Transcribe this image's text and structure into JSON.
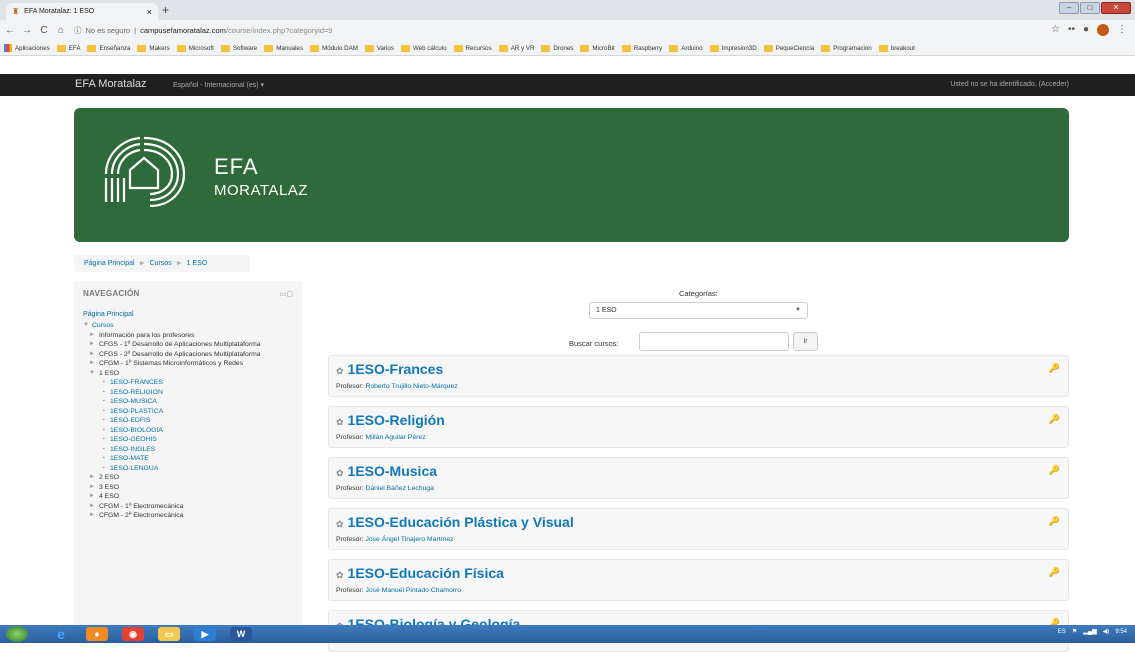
{
  "browser": {
    "tab_title": "EFA Moratalaz: 1 ESO",
    "tab_close": "×",
    "new_tab": "+",
    "security": "No es seguro",
    "url_host": "campusefamoratalaz.com",
    "url_path": "/course/index.php?categoryid=9",
    "bookmarks": [
      "Aplicaciones",
      "EFA",
      "Enseñanza",
      "Makers",
      "Microsoft",
      "Software",
      "Manuales",
      "Módulo DAM",
      "Varios",
      "Web cálculo",
      "Recursos",
      "AR y VR",
      "Drones",
      "MicroBit",
      "Raspberry",
      "Arduino",
      "Impresion3D",
      "PequeCiencia",
      "Programacion",
      "breakout"
    ]
  },
  "navbar": {
    "brand": "EFA Moratalaz",
    "language": "Español - Internacional (es) ▾",
    "login": "Usted no se ha identificado. (Acceder)"
  },
  "banner": {
    "title": "EFA",
    "subtitle": "MORATALAZ"
  },
  "breadcrumb": {
    "home": "Página Principal",
    "courses": "Cursos",
    "current": "1 ESO",
    "sep": "►"
  },
  "navigation": {
    "header": "NAVEGACIÓN",
    "home": "Página Principal",
    "courses": "Cursos",
    "categories": [
      "Información para los profesores",
      "CFGS - 1º Desarrollo de Aplicaciones Multiplataforma",
      "CFGS - 2º Desarrollo de Aplicaciones Multiplataforma",
      "CFGM - 1º Sistemas Microinformáticos y Redes"
    ],
    "open_category": "1 ESO",
    "sub_courses": [
      "1ESO-FRANCES",
      "1ESO-RELIGION",
      "1ESO-MUSICA",
      "1ESO-PLASTICA",
      "1ESO-EDFIS",
      "1ESO-BIOLOGIA",
      "1ESO-GEOHIS",
      "1ESO-INGLES",
      "1ESO-MATE",
      "1ESO-LENGUA"
    ],
    "more_categories": [
      "2 ESO",
      "3 ESO",
      "4 ESO",
      "CFGM - 1º Electromecánica",
      "CFGM - 2º Electromecánica"
    ]
  },
  "main": {
    "categories_label": "Categorías:",
    "selected_category": "1 ESO",
    "search_label": "Buscar cursos:",
    "search_button": "Ir",
    "teacher_prefix": "Profesor: ",
    "courses": [
      {
        "name": "1ESO-Frances",
        "teacher": "Roberto Trujillo Nieto-Márquez"
      },
      {
        "name": "1ESO-Religión",
        "teacher": "Millán Aguilar Pérez"
      },
      {
        "name": "1ESO-Musica",
        "teacher": "Daniel Báñez Lechuga"
      },
      {
        "name": "1ESO-Educación Plástica y Visual",
        "teacher": "Jose Ángel Tinajero Martínez"
      },
      {
        "name": "1ESO-Educación Física",
        "teacher": "José Manuel Pintado Chamorro"
      },
      {
        "name": "1ESO-Biología y Geología",
        "teacher": ""
      }
    ]
  },
  "taskbar": {
    "lang": "ES",
    "time": "9:54"
  }
}
